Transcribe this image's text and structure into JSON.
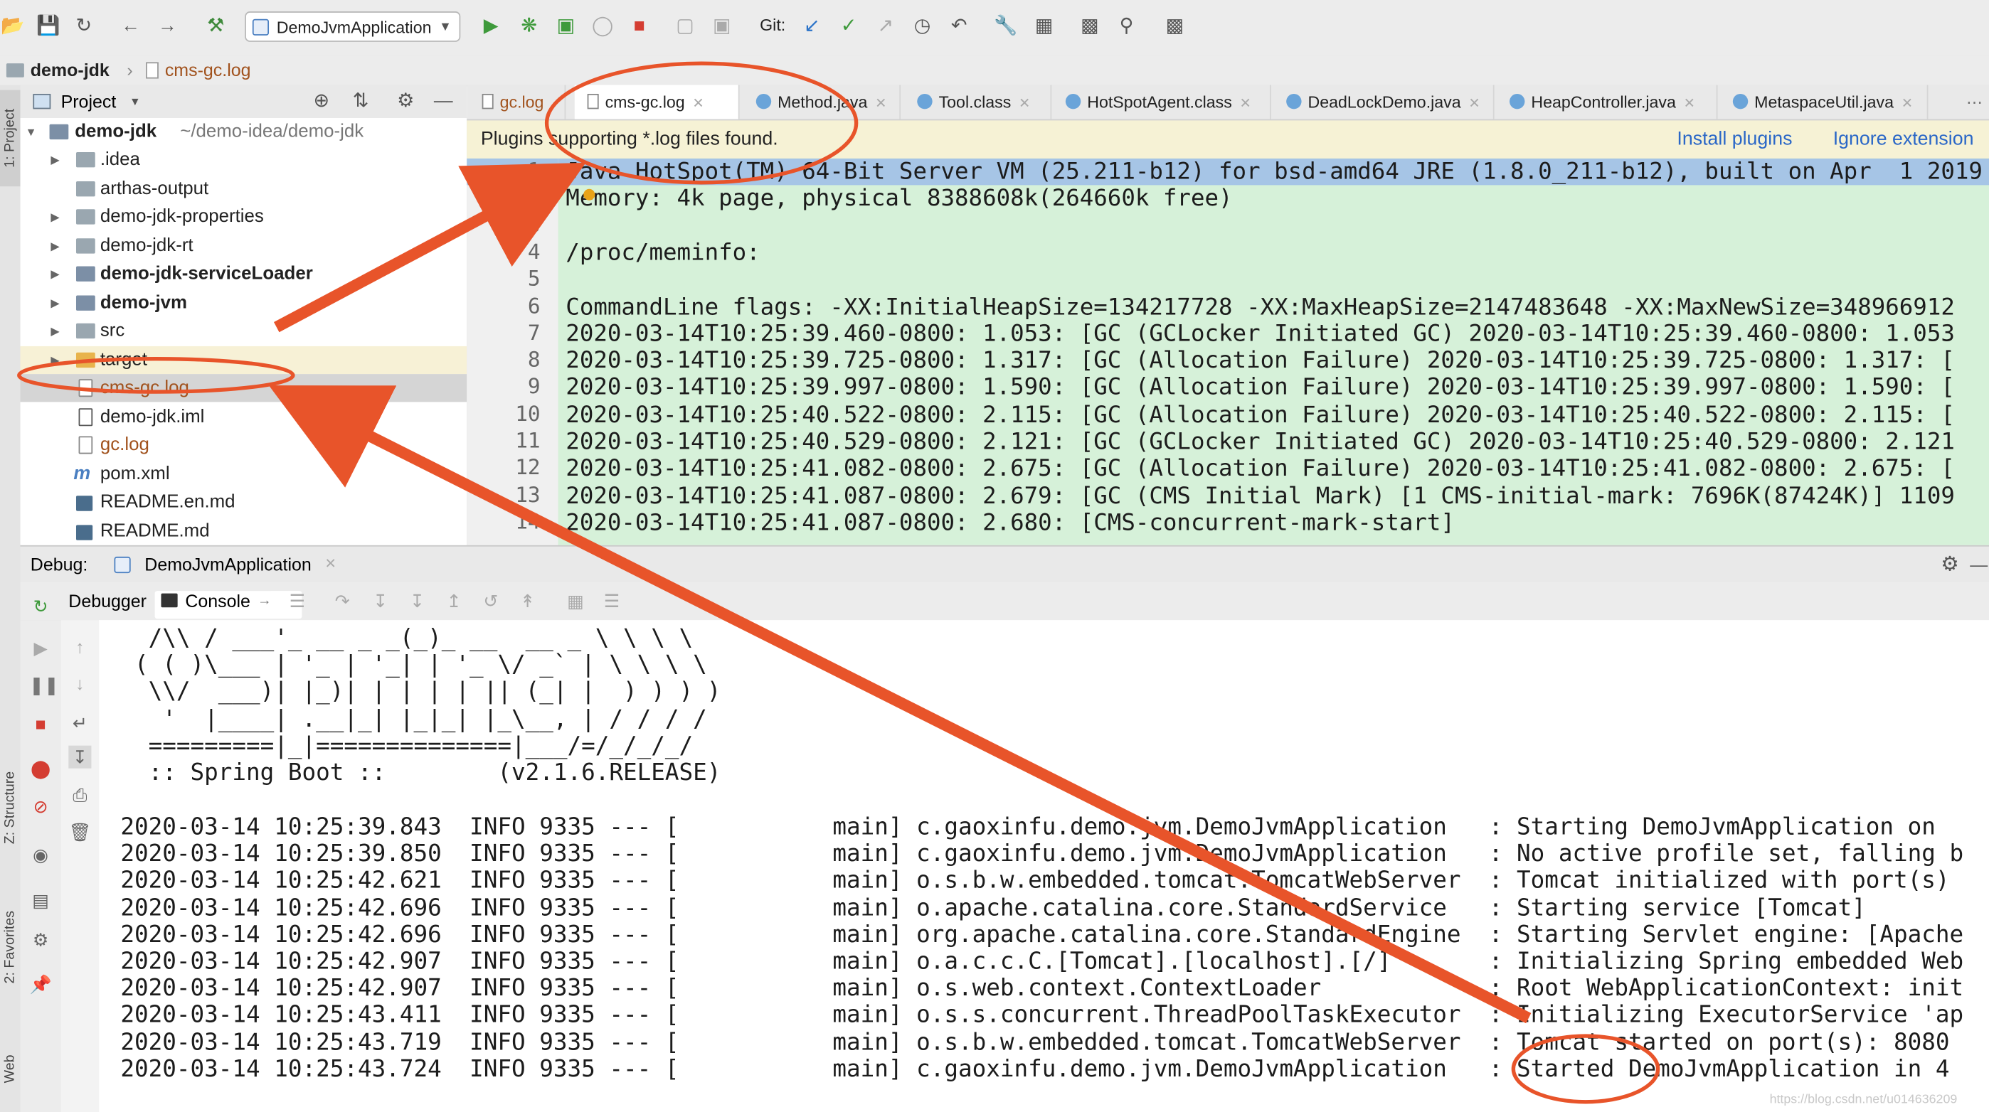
{
  "toolbar": {
    "run_config": "DemoJvmApplication",
    "git_label": "Git:",
    "icons": [
      "open-icon",
      "save-icon",
      "sync-icon",
      "back-icon",
      "forward-icon",
      "build-icon",
      "run-icon",
      "debug-icon",
      "coverage-icon",
      "profile-icon",
      "stop-icon",
      "git-update-icon",
      "git-commit-icon",
      "git-push-icon",
      "history-icon",
      "revert-icon",
      "settings-icon",
      "structure-icon",
      "terminal-icon",
      "search-icon",
      "presentation-icon"
    ]
  },
  "breadcrumb": {
    "project": "demo-jdk",
    "file": "cms-gc.log"
  },
  "side_tabs": {
    "project": "1: Project",
    "structure": "Z: Structure",
    "favorites": "2: Favorites",
    "web": "Web"
  },
  "project_panel": {
    "title": "Project",
    "root_name": "demo-jdk",
    "root_path": "~/demo-idea/demo-jdk",
    "items": [
      {
        "label": "demo-jdk",
        "bold": true
      },
      {
        "label": ".idea"
      },
      {
        "label": "arthas-output"
      },
      {
        "label": "demo-jdk-properties"
      },
      {
        "label": "demo-jdk-rt"
      },
      {
        "label": "demo-jdk-serviceLoader"
      },
      {
        "label": "demo-jvm"
      },
      {
        "label": "src"
      },
      {
        "label": "target"
      },
      {
        "label": "cms-gc.log"
      },
      {
        "label": "demo-jdk.iml"
      },
      {
        "label": "gc.log"
      },
      {
        "label": "pom.xml"
      },
      {
        "label": "README.en.md"
      },
      {
        "label": "README.md"
      }
    ]
  },
  "editor": {
    "tabs": [
      {
        "label": "gc.log"
      },
      {
        "label": "cms-gc.log"
      },
      {
        "label": "Method.java"
      },
      {
        "label": "Tool.class"
      },
      {
        "label": "HotSpotAgent.class"
      },
      {
        "label": "DeadLockDemo.java"
      },
      {
        "label": "HeapController.java"
      },
      {
        "label": "MetaspaceUtil.java"
      }
    ],
    "active_tab": "cms-gc.log",
    "plugin_notice": "Plugins supporting *.log files found.",
    "install_link": "Install plugins",
    "ignore_link": "Ignore extension",
    "lines": [
      {
        "n": "1",
        "text": "Java HotSpot(TM) 64-Bit Server VM (25.211-b12) for bsd-amd64 JRE (1.8.0_211-b12), built on Apr  1 2019"
      },
      {
        "n": "2",
        "text": "Memory: 4k page, physical 8388608k(264660k free)"
      },
      {
        "n": "3",
        "text": ""
      },
      {
        "n": "4",
        "text": "/proc/meminfo:"
      },
      {
        "n": "5",
        "text": ""
      },
      {
        "n": "6",
        "text": "CommandLine flags: -XX:InitialHeapSize=134217728 -XX:MaxHeapSize=2147483648 -XX:MaxNewSize=348966912"
      },
      {
        "n": "7",
        "text": "2020-03-14T10:25:39.460-0800: 1.053: [GC (GCLocker Initiated GC) 2020-03-14T10:25:39.460-0800: 1.053"
      },
      {
        "n": "8",
        "text": "2020-03-14T10:25:39.725-0800: 1.317: [GC (Allocation Failure) 2020-03-14T10:25:39.725-0800: 1.317: ["
      },
      {
        "n": "9",
        "text": "2020-03-14T10:25:39.997-0800: 1.590: [GC (Allocation Failure) 2020-03-14T10:25:39.997-0800: 1.590: ["
      },
      {
        "n": "10",
        "text": "2020-03-14T10:25:40.522-0800: 2.115: [GC (Allocation Failure) 2020-03-14T10:25:40.522-0800: 2.115: ["
      },
      {
        "n": "11",
        "text": "2020-03-14T10:25:40.529-0800: 2.121: [GC (GCLocker Initiated GC) 2020-03-14T10:25:40.529-0800: 2.121"
      },
      {
        "n": "12",
        "text": "2020-03-14T10:25:41.082-0800: 2.675: [GC (Allocation Failure) 2020-03-14T10:25:41.082-0800: 2.675: ["
      },
      {
        "n": "13",
        "text": "2020-03-14T10:25:41.087-0800: 2.679: [GC (CMS Initial Mark) [1 CMS-initial-mark: 7696K(87424K)] 1109"
      },
      {
        "n": "14",
        "text": "2020-03-14T10:25:41.087-0800: 2.680: [CMS-concurrent-mark-start]"
      }
    ]
  },
  "debug": {
    "label": "Debug:",
    "session": "DemoJvmApplication",
    "tabs": [
      "Debugger",
      "Console"
    ],
    "console_lines": [
      "  /\\\\ / ___'_ __ _ _(_)_ __  __ _ \\ \\ \\ \\",
      " ( ( )\\___ | '_ | '_| | '_ \\/ _` | \\ \\ \\ \\",
      "  \\\\/  ___)| |_)| | | | | || (_| |  ) ) ) )",
      "   '  |____| .__|_| |_|_| |_\\__, | / / / /",
      "  =========|_|==============|___/=/_/_/_/",
      "  :: Spring Boot ::        (v2.1.6.RELEASE)",
      "",
      "2020-03-14 10:25:39.843  INFO 9335 --- [           main] c.gaoxinfu.demo.jvm.DemoJvmApplication   : Starting DemoJvmApplication on",
      "2020-03-14 10:25:39.850  INFO 9335 --- [           main] c.gaoxinfu.demo.jvm.DemoJvmApplication   : No active profile set, falling b",
      "2020-03-14 10:25:42.621  INFO 9335 --- [           main] o.s.b.w.embedded.tomcat.TomcatWebServer  : Tomcat initialized with port(s)",
      "2020-03-14 10:25:42.696  INFO 9335 --- [           main] o.apache.catalina.core.StandardService   : Starting service [Tomcat]",
      "2020-03-14 10:25:42.696  INFO 9335 --- [           main] org.apache.catalina.core.StandardEngine  : Starting Servlet engine: [Apache",
      "2020-03-14 10:25:42.907  INFO 9335 --- [           main] o.a.c.c.C.[Tomcat].[localhost].[/]       : Initializing Spring embedded Web",
      "2020-03-14 10:25:42.907  INFO 9335 --- [           main] o.s.web.context.ContextLoader            : Root WebApplicationContext: init",
      "2020-03-14 10:25:43.411  INFO 9335 --- [           main] o.s.s.concurrent.ThreadPoolTaskExecutor  : Initializing ExecutorService 'ap",
      "2020-03-14 10:25:43.719  INFO 9335 --- [           main] o.s.b.w.embedded.tomcat.TomcatWebServer  : Tomcat started on port(s): 8080",
      "2020-03-14 10:25:43.724  INFO 9335 --- [           main] c.gaoxinfu.demo.jvm.DemoJvmApplication   : Started DemoJvmApplication in 4"
    ]
  },
  "annotation_color": "#e8542a",
  "watermark": "https://blog.csdn.net/u014636209"
}
